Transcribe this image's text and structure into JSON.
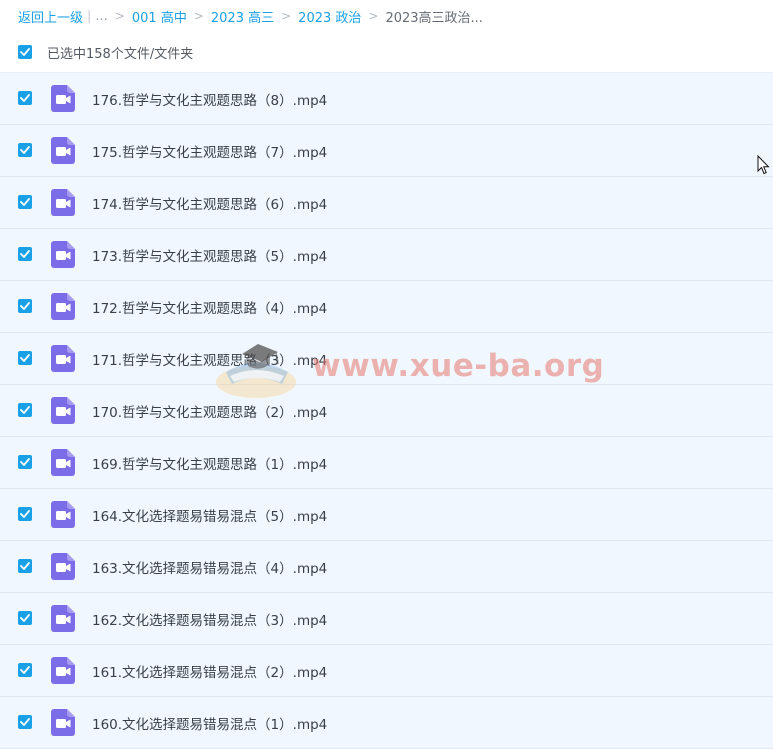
{
  "breadcrumb": {
    "back_label": "返回上一级",
    "separator_bar": "|",
    "ellipsis": "...",
    "items": [
      "001 高中",
      "2023 高三",
      "2023 政治"
    ],
    "current": "2023高三政治..."
  },
  "selection": {
    "label": "已选中158个文件/文件夹",
    "checked": true
  },
  "files": [
    {
      "name": "176.哲学与文化主观题思路（8）.mp4",
      "checked": true
    },
    {
      "name": "175.哲学与文化主观题思路（7）.mp4",
      "checked": true
    },
    {
      "name": "174.哲学与文化主观题思路（6）.mp4",
      "checked": true
    },
    {
      "name": "173.哲学与文化主观题思路（5）.mp4",
      "checked": true
    },
    {
      "name": "172.哲学与文化主观题思路（4）.mp4",
      "checked": true
    },
    {
      "name": "171.哲学与文化主观题思路（3）.mp4",
      "checked": true
    },
    {
      "name": "170.哲学与文化主观题思路（2）.mp4",
      "checked": true
    },
    {
      "name": "169.哲学与文化主观题思路（1）.mp4",
      "checked": true
    },
    {
      "name": "164.文化选择题易错易混点（5）.mp4",
      "checked": true
    },
    {
      "name": "163.文化选择题易错易混点（4）.mp4",
      "checked": true
    },
    {
      "name": "162.文化选择题易错易混点（3）.mp4",
      "checked": true
    },
    {
      "name": "161.文化选择题易错易混点（2）.mp4",
      "checked": true
    },
    {
      "name": "160.文化选择题易错易混点（1）.mp4",
      "checked": true
    }
  ],
  "watermark": {
    "text": "www.xue-ba.org"
  },
  "colors": {
    "accent": "#1aa0e6",
    "video_icon": "#7b6ce8",
    "row_bg": "#f1f7fe"
  },
  "icons": {
    "checkbox": "check-icon",
    "file": "video-file-icon",
    "watermark_logo": "graduation-cap-icon",
    "cursor": "mouse-pointer-icon"
  }
}
